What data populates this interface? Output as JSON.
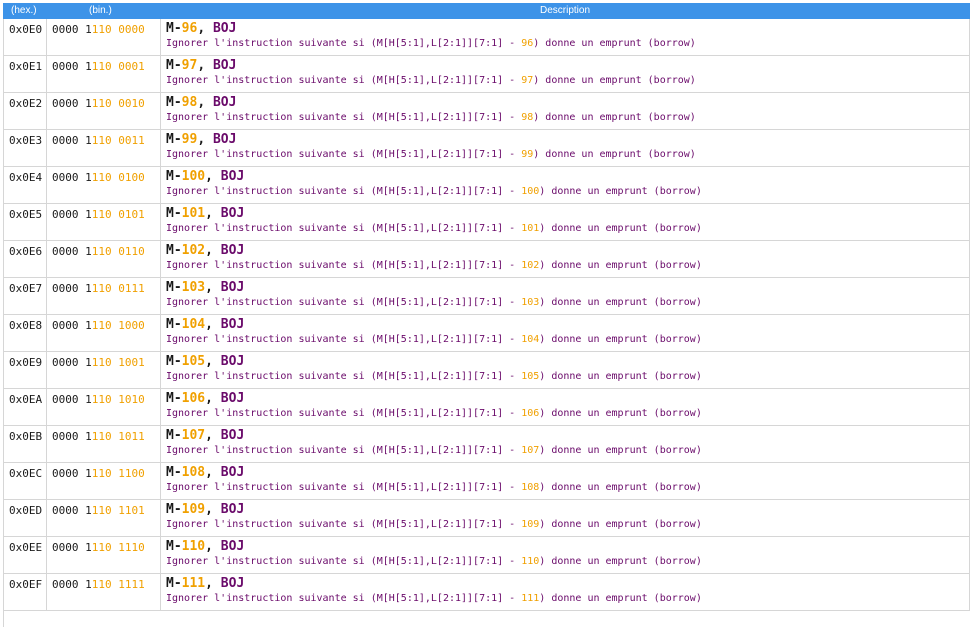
{
  "header": {
    "hex_label": "(hex.)",
    "bin_label": "(bin.)",
    "desc_label": "Description"
  },
  "colors": {
    "header_bg": "#3d93e8",
    "accent_orange": "#f0a000",
    "purple": "#6a0a6a",
    "grid": "#d6d6d6"
  },
  "rows": [
    {
      "hex": "0x0E0",
      "bin_a": "0000 1",
      "bin_b": "110 0000",
      "prefix": "M-",
      "num": "96",
      "sep": ", ",
      "op": "BOJ",
      "desc_pre": "Ignorer l'instruction suivante si (M[H[5:1],L[2:1]][7:1] - ",
      "desc_val": "96",
      "desc_post": ") donne un emprunt (borrow)"
    },
    {
      "hex": "0x0E1",
      "bin_a": "0000 1",
      "bin_b": "110 0001",
      "prefix": "M-",
      "num": "97",
      "sep": ", ",
      "op": "BOJ",
      "desc_pre": "Ignorer l'instruction suivante si (M[H[5:1],L[2:1]][7:1] - ",
      "desc_val": "97",
      "desc_post": ") donne un emprunt (borrow)"
    },
    {
      "hex": "0x0E2",
      "bin_a": "0000 1",
      "bin_b": "110 0010",
      "prefix": "M-",
      "num": "98",
      "sep": ", ",
      "op": "BOJ",
      "desc_pre": "Ignorer l'instruction suivante si (M[H[5:1],L[2:1]][7:1] - ",
      "desc_val": "98",
      "desc_post": ") donne un emprunt (borrow)"
    },
    {
      "hex": "0x0E3",
      "bin_a": "0000 1",
      "bin_b": "110 0011",
      "prefix": "M-",
      "num": "99",
      "sep": ", ",
      "op": "BOJ",
      "desc_pre": "Ignorer l'instruction suivante si (M[H[5:1],L[2:1]][7:1] - ",
      "desc_val": "99",
      "desc_post": ") donne un emprunt (borrow)"
    },
    {
      "hex": "0x0E4",
      "bin_a": "0000 1",
      "bin_b": "110 0100",
      "prefix": "M-",
      "num": "100",
      "sep": ", ",
      "op": "BOJ",
      "desc_pre": "Ignorer l'instruction suivante si (M[H[5:1],L[2:1]][7:1] - ",
      "desc_val": "100",
      "desc_post": ") donne un emprunt (borrow)"
    },
    {
      "hex": "0x0E5",
      "bin_a": "0000 1",
      "bin_b": "110 0101",
      "prefix": "M-",
      "num": "101",
      "sep": ", ",
      "op": "BOJ",
      "desc_pre": "Ignorer l'instruction suivante si (M[H[5:1],L[2:1]][7:1] - ",
      "desc_val": "101",
      "desc_post": ") donne un emprunt (borrow)"
    },
    {
      "hex": "0x0E6",
      "bin_a": "0000 1",
      "bin_b": "110 0110",
      "prefix": "M-",
      "num": "102",
      "sep": ", ",
      "op": "BOJ",
      "desc_pre": "Ignorer l'instruction suivante si (M[H[5:1],L[2:1]][7:1] - ",
      "desc_val": "102",
      "desc_post": ") donne un emprunt (borrow)"
    },
    {
      "hex": "0x0E7",
      "bin_a": "0000 1",
      "bin_b": "110 0111",
      "prefix": "M-",
      "num": "103",
      "sep": ", ",
      "op": "BOJ",
      "desc_pre": "Ignorer l'instruction suivante si (M[H[5:1],L[2:1]][7:1] - ",
      "desc_val": "103",
      "desc_post": ") donne un emprunt (borrow)"
    },
    {
      "hex": "0x0E8",
      "bin_a": "0000 1",
      "bin_b": "110 1000",
      "prefix": "M-",
      "num": "104",
      "sep": ", ",
      "op": "BOJ",
      "desc_pre": "Ignorer l'instruction suivante si (M[H[5:1],L[2:1]][7:1] - ",
      "desc_val": "104",
      "desc_post": ") donne un emprunt (borrow)"
    },
    {
      "hex": "0x0E9",
      "bin_a": "0000 1",
      "bin_b": "110 1001",
      "prefix": "M-",
      "num": "105",
      "sep": ", ",
      "op": "BOJ",
      "desc_pre": "Ignorer l'instruction suivante si (M[H[5:1],L[2:1]][7:1] - ",
      "desc_val": "105",
      "desc_post": ") donne un emprunt (borrow)"
    },
    {
      "hex": "0x0EA",
      "bin_a": "0000 1",
      "bin_b": "110 1010",
      "prefix": "M-",
      "num": "106",
      "sep": ", ",
      "op": "BOJ",
      "desc_pre": "Ignorer l'instruction suivante si (M[H[5:1],L[2:1]][7:1] - ",
      "desc_val": "106",
      "desc_post": ") donne un emprunt (borrow)"
    },
    {
      "hex": "0x0EB",
      "bin_a": "0000 1",
      "bin_b": "110 1011",
      "prefix": "M-",
      "num": "107",
      "sep": ", ",
      "op": "BOJ",
      "desc_pre": "Ignorer l'instruction suivante si (M[H[5:1],L[2:1]][7:1] - ",
      "desc_val": "107",
      "desc_post": ") donne un emprunt (borrow)"
    },
    {
      "hex": "0x0EC",
      "bin_a": "0000 1",
      "bin_b": "110 1100",
      "prefix": "M-",
      "num": "108",
      "sep": ", ",
      "op": "BOJ",
      "desc_pre": "Ignorer l'instruction suivante si (M[H[5:1],L[2:1]][7:1] - ",
      "desc_val": "108",
      "desc_post": ") donne un emprunt (borrow)"
    },
    {
      "hex": "0x0ED",
      "bin_a": "0000 1",
      "bin_b": "110 1101",
      "prefix": "M-",
      "num": "109",
      "sep": ", ",
      "op": "BOJ",
      "desc_pre": "Ignorer l'instruction suivante si (M[H[5:1],L[2:1]][7:1] - ",
      "desc_val": "109",
      "desc_post": ") donne un emprunt (borrow)"
    },
    {
      "hex": "0x0EE",
      "bin_a": "0000 1",
      "bin_b": "110 1110",
      "prefix": "M-",
      "num": "110",
      "sep": ", ",
      "op": "BOJ",
      "desc_pre": "Ignorer l'instruction suivante si (M[H[5:1],L[2:1]][7:1] - ",
      "desc_val": "110",
      "desc_post": ") donne un emprunt (borrow)"
    },
    {
      "hex": "0x0EF",
      "bin_a": "0000 1",
      "bin_b": "110 1111",
      "prefix": "M-",
      "num": "111",
      "sep": ", ",
      "op": "BOJ",
      "desc_pre": "Ignorer l'instruction suivante si (M[H[5:1],L[2:1]][7:1] - ",
      "desc_val": "111",
      "desc_post": ") donne un emprunt (borrow)"
    }
  ]
}
